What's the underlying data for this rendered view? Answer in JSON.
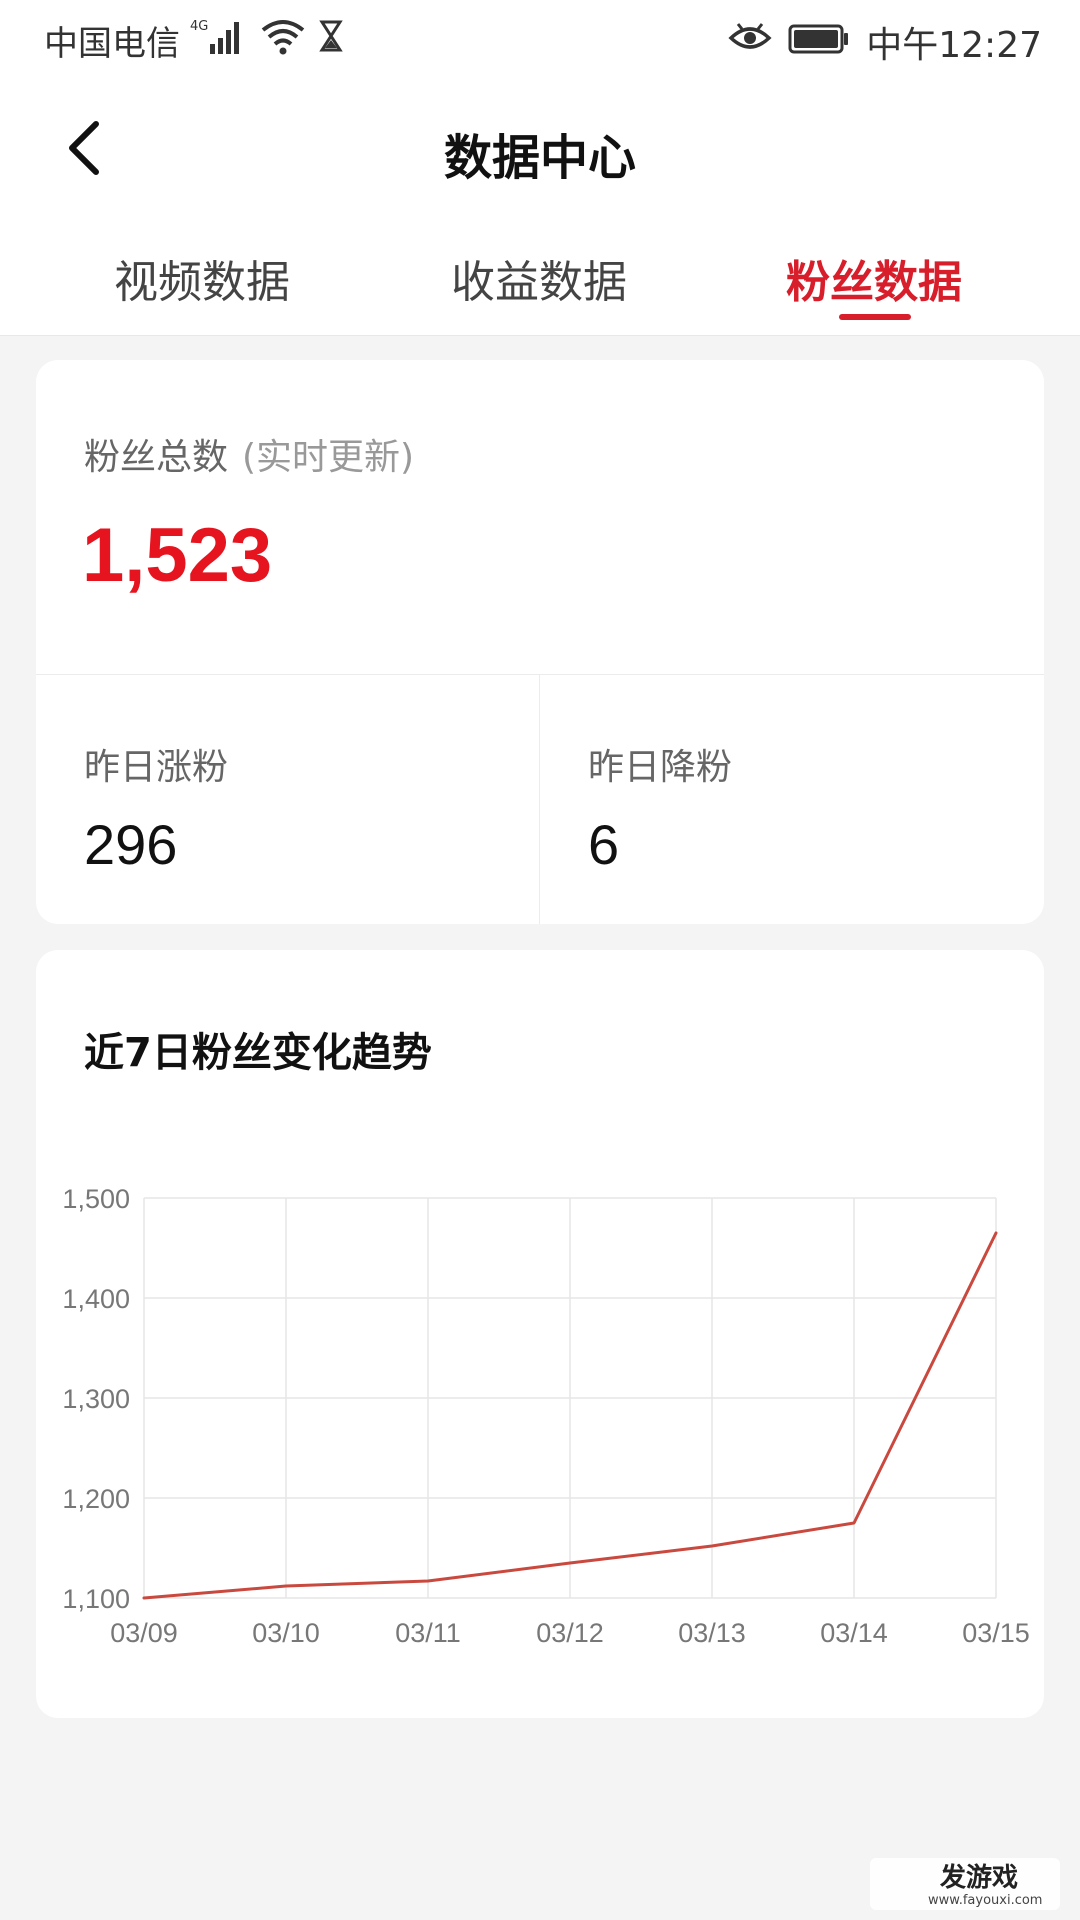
{
  "status_bar": {
    "carrier": "中国电信",
    "network": "4G",
    "time": "中午12:27"
  },
  "header": {
    "title": "数据中心"
  },
  "tabs": [
    {
      "label": "视频数据",
      "active": false
    },
    {
      "label": "收益数据",
      "active": false
    },
    {
      "label": "粉丝数据",
      "active": true
    }
  ],
  "fans": {
    "total_label": "粉丝总数",
    "total_hint": "(实时更新)",
    "total_value": "1,523",
    "yesterday_gain_label": "昨日涨粉",
    "yesterday_gain_value": "296",
    "yesterday_loss_label": "昨日降粉",
    "yesterday_loss_value": "6"
  },
  "chart_title": "近7日粉丝变化趋势",
  "chart_data": {
    "type": "line",
    "x": [
      "03/09",
      "03/10",
      "03/11",
      "03/12",
      "03/13",
      "03/14",
      "03/15"
    ],
    "series": [
      {
        "values": [
          1100,
          1112,
          1117,
          1135,
          1152,
          1175,
          1465
        ]
      }
    ],
    "ylim": [
      1100,
      1500
    ],
    "yticks": [
      1100,
      1200,
      1300,
      1400,
      1500
    ],
    "ytick_labels": [
      "1,100",
      "1,200",
      "1,300",
      "1,400",
      "1,500"
    ],
    "grid": true,
    "line_color": "#c9493f"
  },
  "colors": {
    "accent": "#d81e2a",
    "total_value": "#e5141e"
  },
  "watermark": {
    "text": "发游戏",
    "url_text": "www.fayouxi.com"
  }
}
